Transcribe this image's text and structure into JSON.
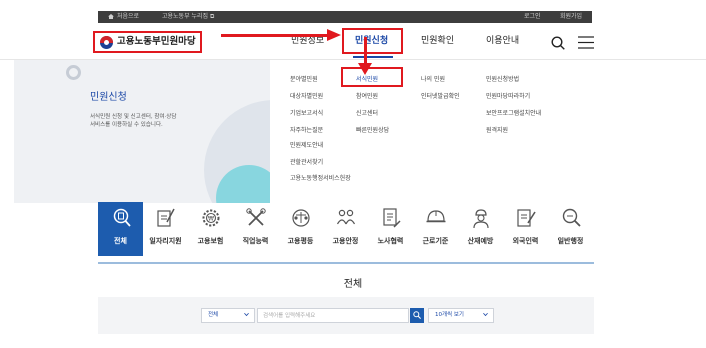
{
  "topbar": {
    "home_label": "처음으로",
    "site_label": "고용노동부 누리집 ⧉",
    "login_label": "로그인",
    "join_label": "회원가입"
  },
  "header": {
    "logo_text": "고용노동부민원마당",
    "nav": [
      "민원정보",
      "민원신청",
      "민원확인",
      "이용안내"
    ],
    "active_nav": "민원신청"
  },
  "panel": {
    "title": "민원신청",
    "desc_line1": "서식민원 신청 및 신고센터, 참여·상담",
    "desc_line2": "서비스를 이용하실 수 있습니다."
  },
  "submenu": {
    "col1": [
      "분야별민원",
      "대상자별민원",
      "기업보고서식",
      "자주하는질문",
      "민원제도안내",
      "관할관서찾기",
      "고용노동행정서비스헌장"
    ],
    "col2": [
      "서식민원",
      "참여민원",
      "신고센터",
      "빠른민원상담"
    ],
    "col3": [
      "나의 민원",
      "인터넷발급확인"
    ],
    "col4": [
      "민원신청방법",
      "민원마당따라하기",
      "보안프로그램설치안내",
      "원격지원"
    ],
    "highlighted": "서식민원"
  },
  "categories": [
    {
      "label": "전체",
      "icon": "search-doc-icon",
      "active": true
    },
    {
      "label": "일자리지원",
      "icon": "pen-paper-icon",
      "active": false
    },
    {
      "label": "고용보험",
      "icon": "gear-won-icon",
      "active": false
    },
    {
      "label": "직업능력",
      "icon": "tools-icon",
      "active": false
    },
    {
      "label": "고용평등",
      "icon": "balance-icon",
      "active": false
    },
    {
      "label": "고용안정",
      "icon": "people-icon",
      "active": false
    },
    {
      "label": "노사협력",
      "icon": "document-icon",
      "active": false
    },
    {
      "label": "근로기준",
      "icon": "helmet-icon",
      "active": false
    },
    {
      "label": "산재예방",
      "icon": "worker-icon",
      "active": false
    },
    {
      "label": "외국인력",
      "icon": "edit-doc-icon",
      "active": false
    },
    {
      "label": "일반행정",
      "icon": "magnifier-icon",
      "active": false
    }
  ],
  "main": {
    "title": "전체"
  },
  "search": {
    "filter_value": "전체",
    "placeholder": "검색어를 입력해주세요",
    "pagesize_value": "10개씩 보기"
  },
  "colors": {
    "accent": "#1d5cae",
    "highlight": "#e0191f",
    "panel_bg": "#eff1f4",
    "teal": "#88d6df"
  }
}
